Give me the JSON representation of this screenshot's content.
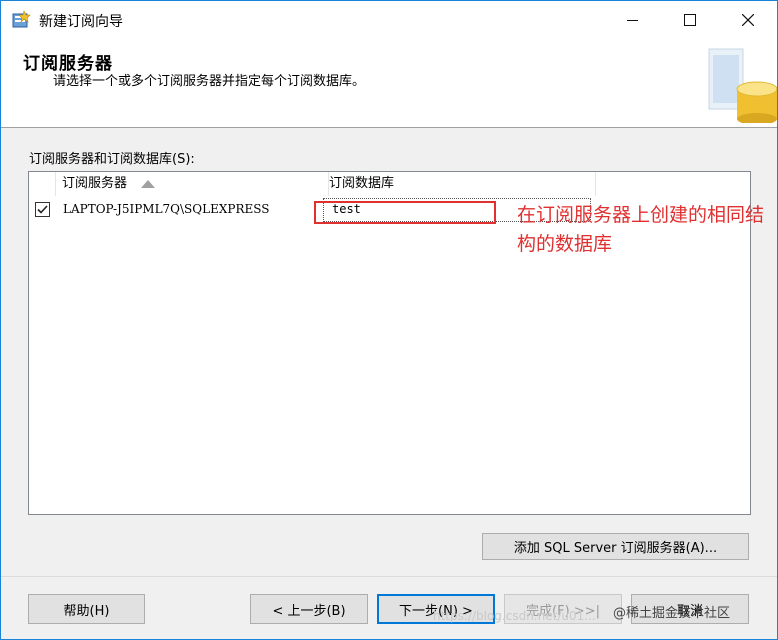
{
  "window": {
    "title": "新建订阅向导",
    "controls": {
      "minimize": "minimize-icon",
      "maximize": "maximize-icon",
      "close": "close-icon"
    }
  },
  "header": {
    "title": "订阅服务器",
    "subtitle": "请选择一个或多个订阅服务器并指定每个订阅数据库。"
  },
  "subscribers": {
    "label": "订阅服务器和订阅数据库(S):",
    "columns": [
      "订阅服务器",
      "订阅数据库"
    ],
    "sort_icon": "sort-up-icon",
    "rows": [
      {
        "checked": true,
        "server": "LAPTOP-J5IPML7Q\\SQLEXPRESS",
        "database": "test"
      }
    ]
  },
  "annotation": {
    "text": "在订阅服务器上创建的相同结构的数据库",
    "color": "#e03030"
  },
  "buttons": {
    "add": "添加 SQL Server 订阅服务器(A)...",
    "help": "帮助(H)",
    "back": "< 上一步(B)",
    "next": "下一步(N) >",
    "finish": "完成(F) >>|",
    "cancel": "取消"
  },
  "watermark": {
    "text": "@稀土掘金技术社区",
    "url_fragment": "https://blog.csdn.net/u01..."
  },
  "colors": {
    "accent": "#0078d7",
    "annotation_red": "#e03030"
  }
}
